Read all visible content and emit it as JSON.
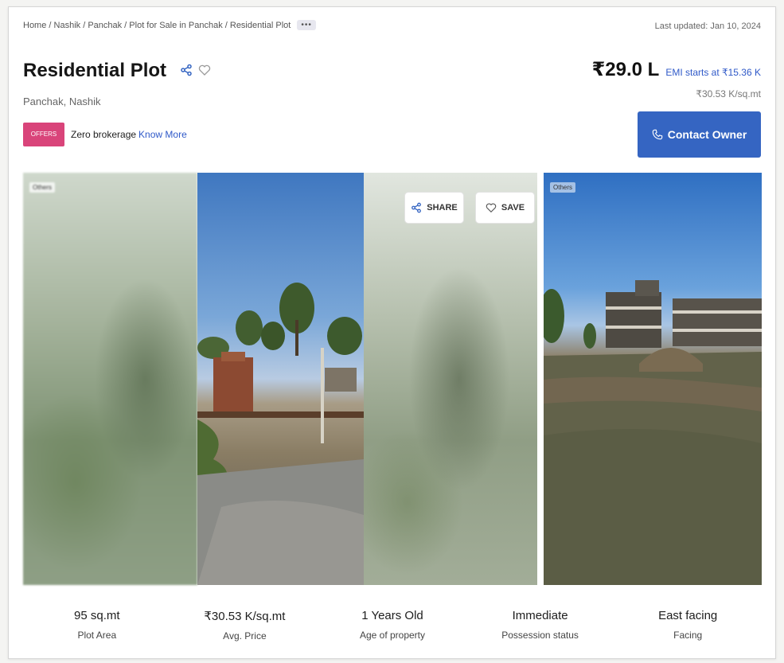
{
  "header": {
    "breadcrumb": [
      "Home",
      "Nashik",
      "Panchak",
      "Plot for Sale in Panchak",
      "Residential Plot"
    ],
    "breadcrumb_more": "•••",
    "last_updated": "Last updated: Jan 10, 2024"
  },
  "listing": {
    "title": "Residential Plot",
    "location": "Panchak, Nashik",
    "offer_badge": "OFFERS",
    "offer_text": "Zero brokerage",
    "offer_link": "Know More",
    "price": "₹29.0 L",
    "emi": "EMI starts at ₹15.36 K",
    "price_per_sqmt": "₹30.53 K/sq.mt",
    "contact_label": "Contact Owner"
  },
  "gallery": {
    "left_tag": "Others",
    "right_tag": "Others",
    "share_label": "SHARE",
    "save_label": "SAVE"
  },
  "stats": [
    {
      "value": "95 sq.mt",
      "label": "Plot Area"
    },
    {
      "value": "₹30.53 K/sq.mt",
      "label": "Avg. Price"
    },
    {
      "value": "1 Years Old",
      "label": "Age of property"
    },
    {
      "value": "Immediate",
      "label": "Possession status"
    },
    {
      "value": "East facing",
      "label": "Facing"
    }
  ],
  "colors": {
    "accent_blue": "#3565c2",
    "link_blue": "#2f59c8",
    "offer_pink": "#d9447a"
  },
  "icons": [
    "share-icon",
    "heart-icon",
    "phone-icon",
    "save-heart-icon"
  ]
}
